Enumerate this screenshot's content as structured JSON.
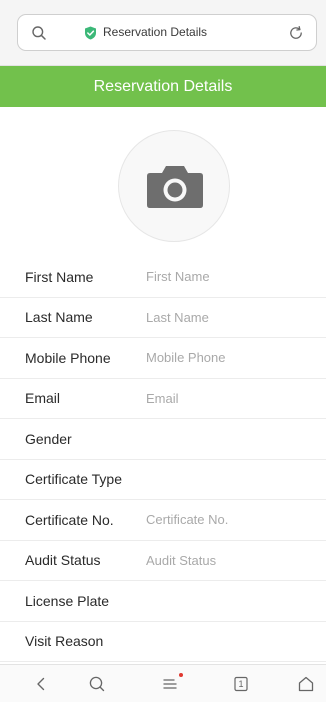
{
  "browser": {
    "url_text": "Reservation Details",
    "tab_count": "1"
  },
  "header": {
    "title": "Reservation Details"
  },
  "form": {
    "fields": [
      {
        "label": "First Name",
        "placeholder": "First Name",
        "value": ""
      },
      {
        "label": "Last Name",
        "placeholder": "Last Name",
        "value": ""
      },
      {
        "label": "Mobile Phone",
        "placeholder": "Mobile Phone",
        "value": ""
      },
      {
        "label": "Email",
        "placeholder": "Email",
        "value": ""
      },
      {
        "label": "Gender",
        "value": ""
      },
      {
        "label": "Certificate Type",
        "value": ""
      },
      {
        "label": "Certificate No.",
        "placeholder": "Certificate No.",
        "value": ""
      },
      {
        "label": "Audit Status",
        "placeholder": "Audit Status",
        "value": ""
      },
      {
        "label": "License Plate",
        "value": ""
      },
      {
        "label": "Visit Reason",
        "value": ""
      }
    ]
  },
  "icons": {
    "url_search": "search-icon",
    "secure": "shield-check-icon",
    "reload": "reload-icon",
    "photo": "camera-icon",
    "back": "chevron-left-icon",
    "search": "search-icon",
    "menu": "menu-icon",
    "tabs": "tabs-icon",
    "home": "home-icon"
  },
  "colors": {
    "header_bg": "#72c14c",
    "secure_icon": "#3cb878",
    "notification_dot": "#e0382f",
    "camera": "#6e6e6e"
  }
}
